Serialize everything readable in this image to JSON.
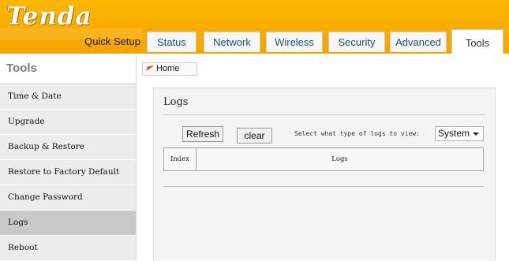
{
  "brand": {
    "logo": "Tenda"
  },
  "tabs": [
    {
      "label": "Quick Setup"
    },
    {
      "label": "Status"
    },
    {
      "label": "Network"
    },
    {
      "label": "Wireless"
    },
    {
      "label": "Security"
    },
    {
      "label": "Advanced"
    },
    {
      "label": "Tools",
      "active": true
    }
  ],
  "sidebar": {
    "title": "Tools",
    "items": [
      {
        "label": "Time & Date"
      },
      {
        "label": "Upgrade"
      },
      {
        "label": "Backup & Restore"
      },
      {
        "label": "Restore to Factory Default"
      },
      {
        "label": "Change Password"
      },
      {
        "label": "Logs",
        "active": true
      },
      {
        "label": "Reboot"
      }
    ]
  },
  "breadcrumb": {
    "label": "Home",
    "icon": "home-arrow-icon"
  },
  "logs": {
    "title": "Logs",
    "refresh_label": "Refresh",
    "clear_label": "clear",
    "filter_label": "Select what type of logs to view:",
    "filter_value": "System",
    "columns": [
      "Index",
      "Logs"
    ]
  },
  "colors": {
    "header": "#f6a800",
    "link": "#1a4d80",
    "active_sidebar": "#c9c9c9"
  }
}
